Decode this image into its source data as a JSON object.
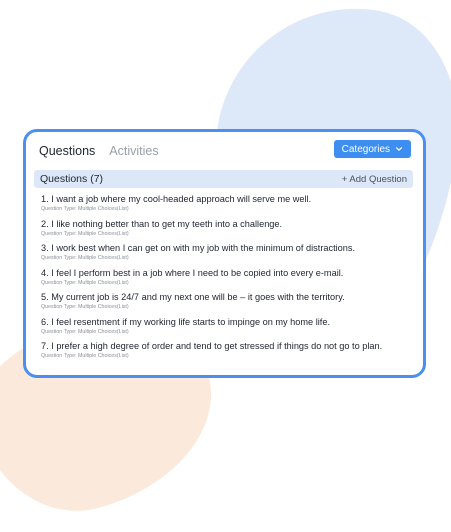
{
  "tabs": [
    {
      "label": "Questions",
      "active": true
    },
    {
      "label": "Activities",
      "active": false
    }
  ],
  "categories_button": {
    "label": "Categories",
    "icon": "chevron-down-icon"
  },
  "list_header": {
    "title": "Questions (7)",
    "add_label": "+ Add Question"
  },
  "questions": [
    {
      "text": "1. I want a job where my cool-headed approach will serve me well.",
      "type": "Question Type: Multiple Choices(List)"
    },
    {
      "text": "2. I like nothing better than to get my teeth into a challenge.",
      "type": "Question Type: Multiple Choices(List)"
    },
    {
      "text": "3. I work best when I can get on with my job with the minimum of distractions.",
      "type": "Question Type: Multiple Choices(List)"
    },
    {
      "text": "4. I feel I perform best in a job where I need to be copied into every e-mail.",
      "type": "Question Type: Multiple Choices(List)"
    },
    {
      "text": "5. My current job is 24/7 and my next one will be – it goes with the territory.",
      "type": "Question Type: Multiple Choices(List)"
    },
    {
      "text": "6. I feel resentment if my working life starts to impinge on my home life.",
      "type": "Question Type: Multiple Choices(List)"
    },
    {
      "text": "7. I prefer a high degree of order and tend to get stressed if things do not go to plan.",
      "type": "Question Type: Multiple Choices(List)"
    }
  ],
  "colors": {
    "accent": "#3d8ef0",
    "border": "#4c8ff0",
    "header_bg": "#dce8f8",
    "blob_blue": "#dde8f8",
    "blob_peach": "#fbe9dc"
  }
}
